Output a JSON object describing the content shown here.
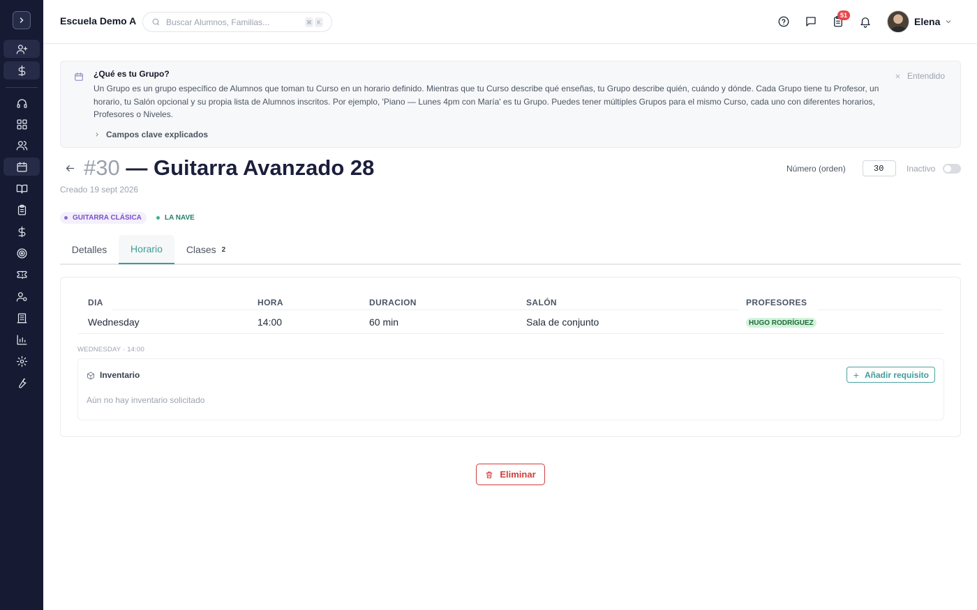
{
  "header": {
    "school_name": "Escuela Demo A",
    "search_placeholder": "Buscar Alumnos, Familias...",
    "shortcut": [
      "⌘",
      "K"
    ],
    "notification_count": "51",
    "user_name": "Elena"
  },
  "sidebar": {
    "items": [
      {
        "icon": "add-user-icon"
      },
      {
        "icon": "dollar-icon"
      },
      {
        "icon": "headset-icon"
      },
      {
        "icon": "dashboard-icon"
      },
      {
        "icon": "users-icon"
      },
      {
        "icon": "calendar-icon"
      },
      {
        "icon": "book-icon"
      },
      {
        "icon": "clipboard-icon"
      },
      {
        "icon": "dollar-icon"
      },
      {
        "icon": "target-icon"
      },
      {
        "icon": "ticket-icon"
      },
      {
        "icon": "user-settings-icon"
      },
      {
        "icon": "building-icon"
      },
      {
        "icon": "bar-chart-icon"
      },
      {
        "icon": "gear-icon"
      },
      {
        "icon": "wrench-icon"
      }
    ]
  },
  "info": {
    "title": "¿Qué es tu Grupo?",
    "body": "Un Grupo es un grupo específico de Alumnos que toman tu Curso en un horario definido. Mientras que tu Curso describe qué enseñas, tu Grupo describe quién, cuándo y dónde. Cada Grupo tiene tu Profesor, un horario, tu Salón opcional y su propia lista de Alumnos inscritos. Por ejemplo, 'Piano — Lunes 4pm con María' es tu Grupo. Puedes tener múltiples Grupos para el mismo Curso, cada uno con diferentes horarios, Profesores o Niveles.",
    "more_label": "Campos clave explicados",
    "dismiss_label": "Entendido"
  },
  "group": {
    "number": "#30",
    "name": "— Guitarra Avanzado 28",
    "created": "Creado 19 sept 2026",
    "order_label": "Número (orden)",
    "order_value": "30",
    "inactive_label": "Inactivo",
    "active": false,
    "tags": [
      {
        "label": "GUITARRA CLÁSICA",
        "color": "#7b4fc9"
      },
      {
        "label": "LA NAVE",
        "color": "#22806a"
      }
    ]
  },
  "tabs": [
    {
      "label": "Detalles",
      "active": false
    },
    {
      "label": "Horario",
      "active": true
    },
    {
      "label": "Clases",
      "count": "2",
      "active": false
    }
  ],
  "schedule": {
    "columns": [
      "DIA",
      "HORA",
      "DURACION",
      "SALÓN",
      "PROFESORES"
    ],
    "rows": [
      {
        "dia": "Wednesday",
        "hora": "14:00",
        "duracion": "60 min",
        "salon": "Sala de conjunto",
        "profesor": "HUGO RODRÍGUEZ"
      }
    ],
    "slot_label": "WEDNESDAY · 14:00",
    "inventory": {
      "title": "Inventario",
      "empty": "Aún no hay inventario solicitado",
      "add_label": "Añadir requisito"
    }
  },
  "actions": {
    "delete_label": "Eliminar"
  },
  "colors": {
    "sidebar_bg": "#161a33",
    "accent": "#3f9c97",
    "danger": "#d23b3b"
  }
}
